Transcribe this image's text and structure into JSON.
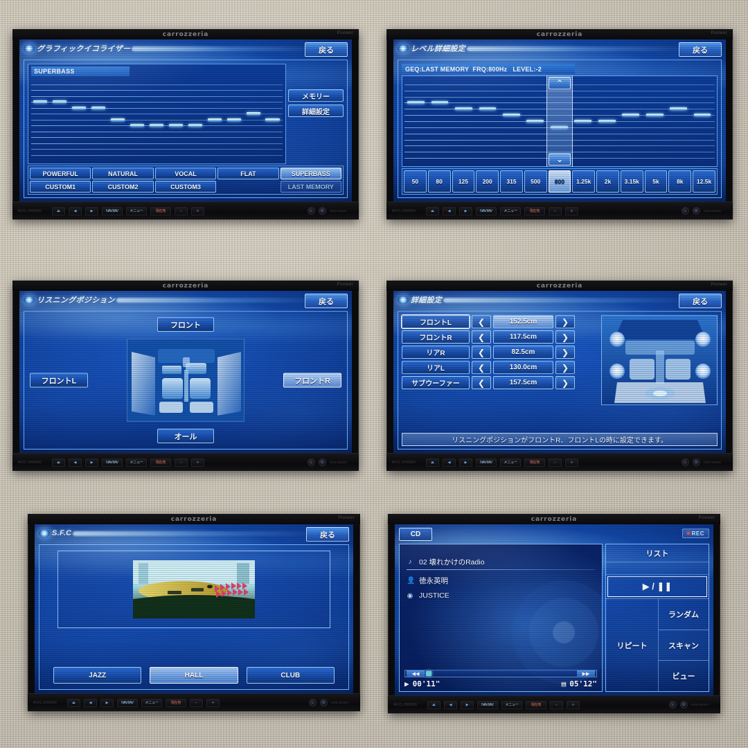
{
  "device": {
    "brand": "carrozzeria",
    "sub_brand": "Pioneer",
    "model": "AVIC-ZH9990",
    "back_label": "戻る",
    "hw_buttons": {
      "eject": "⏏",
      "prev": "◀",
      "next": "▶",
      "navi_av": "NAVI/AV",
      "menu": "メニュー",
      "current": "現在地",
      "minus": "−",
      "plus": "＋",
      "lock": "⌂",
      "open": "⏻",
      "note": "HDD MUSIC"
    }
  },
  "panels": [
    {
      "id": "graphic-equalizer",
      "title": "グラフィックイコライザー",
      "preset_name": "SUPERBASS",
      "side_buttons": [
        {
          "label": "メモリー",
          "name": "memory-button"
        },
        {
          "label": "詳細設定",
          "name": "detail-setting-button"
        }
      ],
      "presets": [
        {
          "label": "POWERFUL",
          "state": "normal"
        },
        {
          "label": "NATURAL",
          "state": "normal"
        },
        {
          "label": "VOCAL",
          "state": "normal"
        },
        {
          "label": "FLAT",
          "state": "normal"
        },
        {
          "label": "SUPERBASS",
          "state": "selected"
        },
        {
          "label": "CUSTOM1",
          "state": "normal"
        },
        {
          "label": "CUSTOM2",
          "state": "normal"
        },
        {
          "label": "CUSTOM3",
          "state": "normal"
        },
        {
          "label": "",
          "state": "empty"
        },
        {
          "label": "LAST MEMORY",
          "state": "dim"
        }
      ],
      "eq_bars": [
        3,
        3,
        4,
        4,
        6,
        7,
        7,
        7,
        7,
        6,
        6,
        5,
        6
      ],
      "eq_rows": 13
    },
    {
      "id": "level-detail-setting",
      "title": "レベル詳細設定",
      "info_line": "GEQ:LAST MEMORY  FRQ:800Hz   LEVEL:-2",
      "info": {
        "geq": "LAST MEMORY",
        "frq": "800Hz",
        "level": "-2"
      },
      "up_arrow": "⌃",
      "down_arrow": "⌄",
      "frequencies": [
        "50",
        "80",
        "125",
        "200",
        "315",
        "500",
        "800",
        "1.25k",
        "2k",
        "3.15k",
        "5k",
        "8k",
        "12.5k"
      ],
      "selected_frequency": "800",
      "eq_bars": [
        3,
        3,
        4,
        4,
        5,
        6,
        7,
        6,
        6,
        5,
        5,
        4,
        5
      ],
      "eq_rows": 13
    },
    {
      "id": "listening-position",
      "title": "リスニングポジション",
      "buttons": {
        "front": "フロント",
        "front_l": "フロントL",
        "front_r": "フロントR",
        "all": "オール"
      },
      "selected": "フロントR"
    },
    {
      "id": "time-alignment-detail",
      "title": "詳細設定",
      "rows": [
        {
          "label": "フロントL",
          "value": "152.5cm",
          "active": true
        },
        {
          "label": "フロントR",
          "value": "117.5cm",
          "active": false
        },
        {
          "label": "リアR",
          "value": "82.5cm",
          "active": false
        },
        {
          "label": "リアL",
          "value": "130.0cm",
          "active": false
        },
        {
          "label": "サブウーファー",
          "value": "157.5cm",
          "active": false
        }
      ],
      "arrow_left": "❮",
      "arrow_right": "❯",
      "message": "リスニングポジションがフロントR、フロントLの時に設定できます。"
    },
    {
      "id": "sfc",
      "title": "S.F.C",
      "modes": [
        {
          "label": "JAZZ",
          "state": "normal"
        },
        {
          "label": "HALL",
          "state": "selected"
        },
        {
          "label": "CLUB",
          "state": "normal"
        }
      ]
    },
    {
      "id": "cd-player",
      "source_label": "CD",
      "rec_label": "REC",
      "track": "02  壊れかけのRadio",
      "artist": "徳永英明",
      "album": "JUSTICE",
      "icons": {
        "track": "♪",
        "artist": "👤",
        "album": "◉",
        "play": "▶",
        "disc": "▤"
      },
      "elapsed": "00'11\"",
      "total": "05'12\"",
      "seek_rew": "◀◀",
      "seek_ff": "▶▶",
      "side_buttons": {
        "list": "リスト",
        "play_pause": "▶ / ❚❚",
        "repeat": "リピート",
        "random": "ランダム",
        "scan": "スキャン",
        "view": "ビュー"
      }
    }
  ],
  "colors": {
    "screen_blue": "#1247a8",
    "accent_cyan": "#a8e0ff",
    "button_border": "#9fd0ff",
    "selected_fill": "#b7d6fa",
    "background": "#cbc4b6",
    "rec_red": "#e8553a"
  }
}
